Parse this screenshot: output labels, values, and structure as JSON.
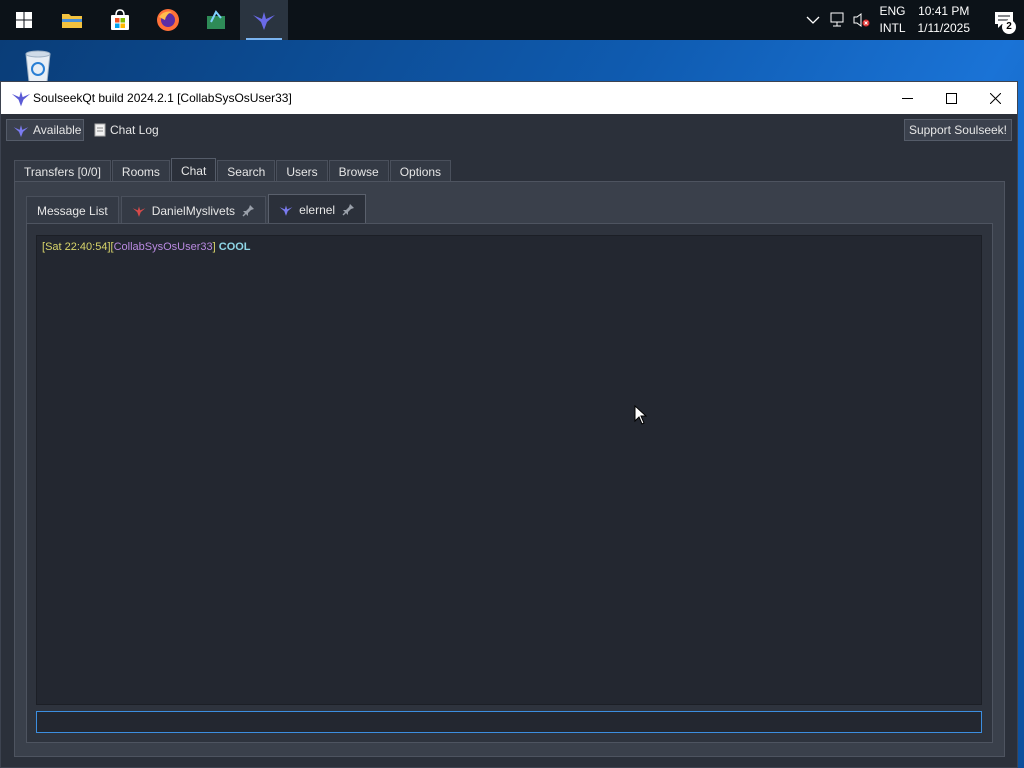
{
  "taskbar": {
    "items": [
      {
        "name": "start",
        "icon": "windows-logo-icon"
      },
      {
        "name": "file-explorer",
        "icon": "folder-icon"
      },
      {
        "name": "microsoft-store",
        "icon": "store-icon"
      },
      {
        "name": "firefox",
        "icon": "firefox-icon"
      },
      {
        "name": "app-green",
        "icon": "green-app-icon"
      },
      {
        "name": "soulseekqt",
        "icon": "soulseek-bird-icon",
        "active": true
      }
    ],
    "tray": {
      "lang_line1": "ENG",
      "lang_line2": "INTL",
      "time": "10:41 PM",
      "date": "1/11/2025",
      "notification_count": "2"
    }
  },
  "window": {
    "title": "SoulseekQt build 2024.2.1 [CollabSysOsUser33]",
    "toolbar": {
      "status_label": "Available",
      "chat_log_label": "Chat Log",
      "support_label": "Support Soulseek!"
    },
    "main_tabs": [
      {
        "label": "Transfers [0/0]"
      },
      {
        "label": "Rooms"
      },
      {
        "label": "Chat",
        "active": true
      },
      {
        "label": "Search"
      },
      {
        "label": "Users"
      },
      {
        "label": "Browse"
      },
      {
        "label": "Options"
      }
    ],
    "chat_tabs": [
      {
        "label": "Message List"
      },
      {
        "label": "DanielMyslivets"
      },
      {
        "label": "elernel",
        "active": true
      }
    ],
    "messages": [
      {
        "time": "Sat 22:40:54",
        "user": "CollabSysOsUser33",
        "text": "COOL"
      }
    ],
    "input_value": ""
  },
  "colors": {
    "accent": "#3c8ee0",
    "timestamp": "#d8d46a",
    "username": "#b98ae0",
    "message": "#8fd6e6"
  }
}
